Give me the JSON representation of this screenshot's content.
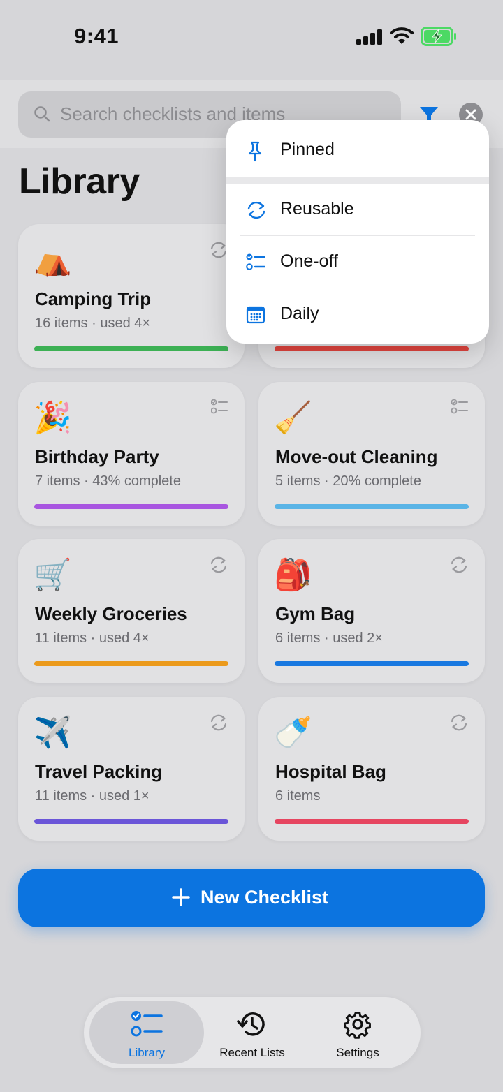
{
  "status_bar": {
    "time": "9:41"
  },
  "search": {
    "placeholder": "Search checklists and items"
  },
  "header": {
    "title": "Library"
  },
  "cards": [
    {
      "emoji": "⛺",
      "title": "Camping Trip",
      "meta": "16 items · used 4×",
      "type": "reusable",
      "accent": "#3cb054"
    },
    {
      "emoji": "",
      "title": "",
      "meta": "",
      "type": "reusable",
      "accent": "#e0443e"
    },
    {
      "emoji": "🎉",
      "title": "Birthday Party",
      "meta": "7 items · 43% complete",
      "type": "one-off",
      "accent": "#a855e0"
    },
    {
      "emoji": "🧹",
      "title": "Move-out Cleaning",
      "meta": "5 items · 20% complete",
      "type": "one-off",
      "accent": "#5ab4e6"
    },
    {
      "emoji": "🛒",
      "title": "Weekly Groceries",
      "meta": "11 items · used 4×",
      "type": "reusable",
      "accent": "#eb9a1c"
    },
    {
      "emoji": "🎒",
      "title": "Gym Bag",
      "meta": "6 items · used 2×",
      "type": "reusable",
      "accent": "#1878e0"
    },
    {
      "emoji": "✈️",
      "title": "Travel Packing",
      "meta": "11 items · used 1×",
      "type": "reusable",
      "accent": "#6a55d8"
    },
    {
      "emoji": "🍼",
      "title": "Hospital Bag",
      "meta": "6 items",
      "type": "reusable",
      "accent": "#e64560"
    }
  ],
  "new_button": {
    "label": "New Checklist"
  },
  "tabs": [
    {
      "label": "Library",
      "icon": "checklist-icon",
      "active": true
    },
    {
      "label": "Recent Lists",
      "icon": "history-icon",
      "active": false
    },
    {
      "label": "Settings",
      "icon": "gear-icon",
      "active": false
    }
  ],
  "filter_menu": {
    "items": [
      {
        "label": "Pinned",
        "icon": "pin-icon"
      },
      {
        "label": "Reusable",
        "icon": "refresh-icon"
      },
      {
        "label": "One-off",
        "icon": "checklist-icon"
      },
      {
        "label": "Daily",
        "icon": "calendar-icon"
      }
    ]
  },
  "colors": {
    "accent": "#0c74e0",
    "battery": "#4cd964"
  }
}
